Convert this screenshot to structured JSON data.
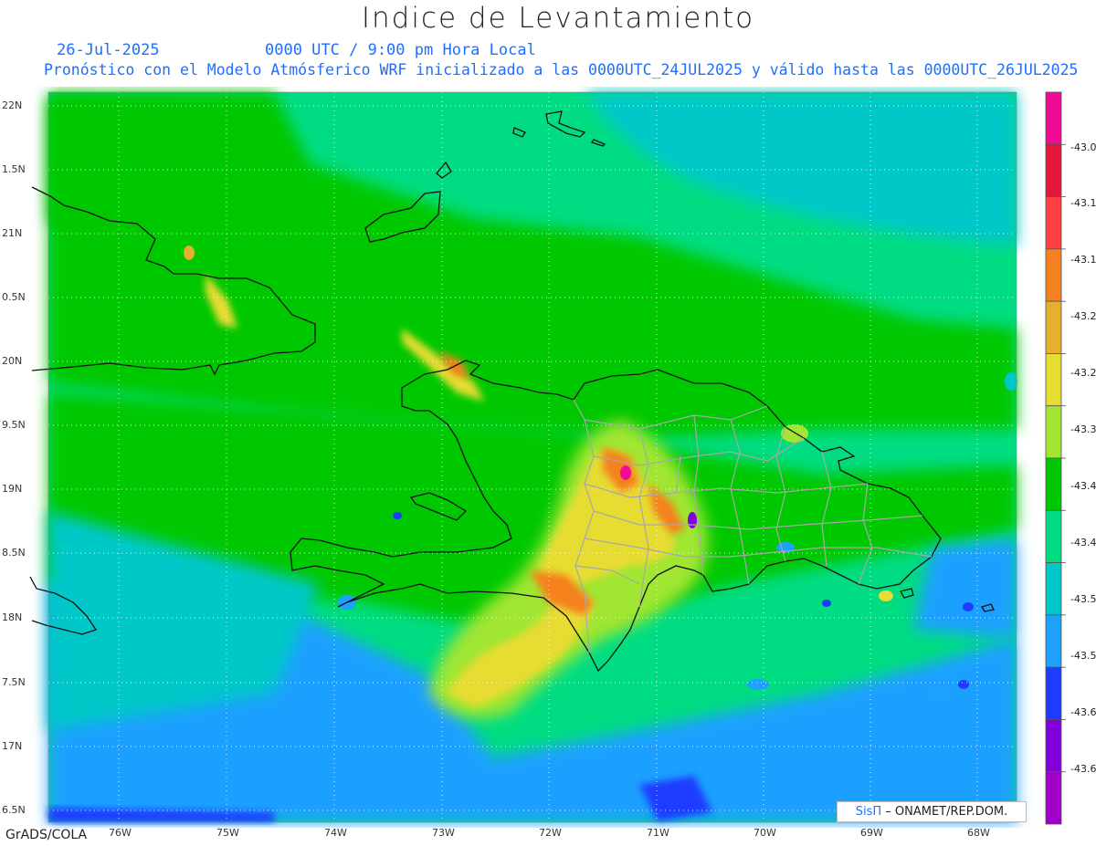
{
  "title": "Indice de Levantamiento",
  "date": "26-Jul-2025",
  "time": "0000 UTC / 9:00 pm Hora Local",
  "description": "Pronóstico con el Modelo Atmósferico WRF inicializado a las 0000UTC_24JUL2025 y válido hasta las  0000UTC_26JUL2025",
  "lat_labels": [
    "22N",
    "1.5N",
    "21N",
    "0.5N",
    "20N",
    "9.5N",
    "19N",
    "8.5N",
    "18N",
    "7.5N",
    "17N",
    "6.5N"
  ],
  "lon_labels": [
    "76W",
    "75W",
    "74W",
    "73W",
    "72W",
    "71W",
    "70W",
    "69W",
    "68W"
  ],
  "colorbar_labels": [
    "-43.0",
    "-43.1",
    "-43.1",
    "-43.2",
    "-43.2",
    "-43.3",
    "-43.4",
    "-43.4",
    "-43.5",
    "-43.5",
    "-43.6",
    "-43.6"
  ],
  "colorbar_colors": [
    "#f00a96",
    "#e3173c",
    "#ff4040",
    "#f5821e",
    "#e6af2d",
    "#e6dc32",
    "#a0e632",
    "#00c800",
    "#00dc82",
    "#00c8c8",
    "#1ea0ff",
    "#1e3cff",
    "#8200dc",
    "#a000c8"
  ],
  "credit_logo": "SisΠ",
  "credit_text": "– ONAMET/REP.DOM.",
  "footer": "GrADS/COLA"
}
